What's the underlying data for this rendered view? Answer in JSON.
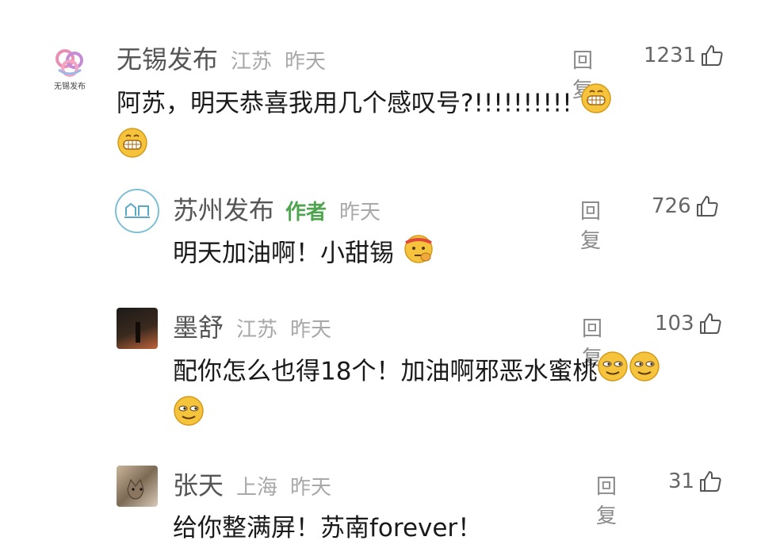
{
  "comments": [
    {
      "user": "无锡发布",
      "region": "江苏",
      "time": "昨天",
      "reply": "回复",
      "likes": "1231",
      "text_line1": "阿苏，明天恭喜我用几个感叹号?!!!!!!!!!!",
      "avatar_caption": "无锡发布",
      "emoji": "grinning-face"
    },
    {
      "user": "苏州发布",
      "badge": "作者",
      "time": "昨天",
      "reply": "回复",
      "likes": "726",
      "text": "明天加油啊！小甜锡",
      "emoji": "thinking-face-headband"
    },
    {
      "user": "墨舒",
      "region": "江苏",
      "time": "昨天",
      "reply": "回复",
      "likes": "103",
      "text_line1": "配你怎么也得18个！加油啊邪恶水蜜桃",
      "emoji": "smirking-face"
    },
    {
      "user": "张天",
      "region": "上海",
      "time": "昨天",
      "reply": "回复",
      "likes": "31",
      "text": "给你整满屏！苏南forever！"
    }
  ],
  "colors": {
    "author_badge": "#4fa54f",
    "username": "#555555",
    "meta": "#a8a8a8"
  }
}
